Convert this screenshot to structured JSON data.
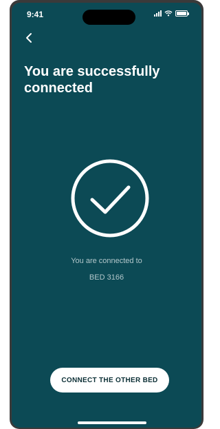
{
  "status_bar": {
    "time": "9:41"
  },
  "header": {
    "title": "You are successfully connected"
  },
  "status": {
    "line1": "You are connected to",
    "line2": "BED 3166"
  },
  "actions": {
    "connect_other_label": "CONNECT THE OTHER BED"
  },
  "icons": {
    "back": "chevron-left-icon",
    "success": "check-circle-icon",
    "signal": "cellular-signal-icon",
    "wifi": "wifi-icon",
    "battery": "battery-icon"
  },
  "colors": {
    "background": "#0c4a55",
    "text": "#ffffff",
    "muted_text": "#b3c7cb",
    "button_bg": "#ffffff",
    "button_text": "#0b2f35"
  }
}
